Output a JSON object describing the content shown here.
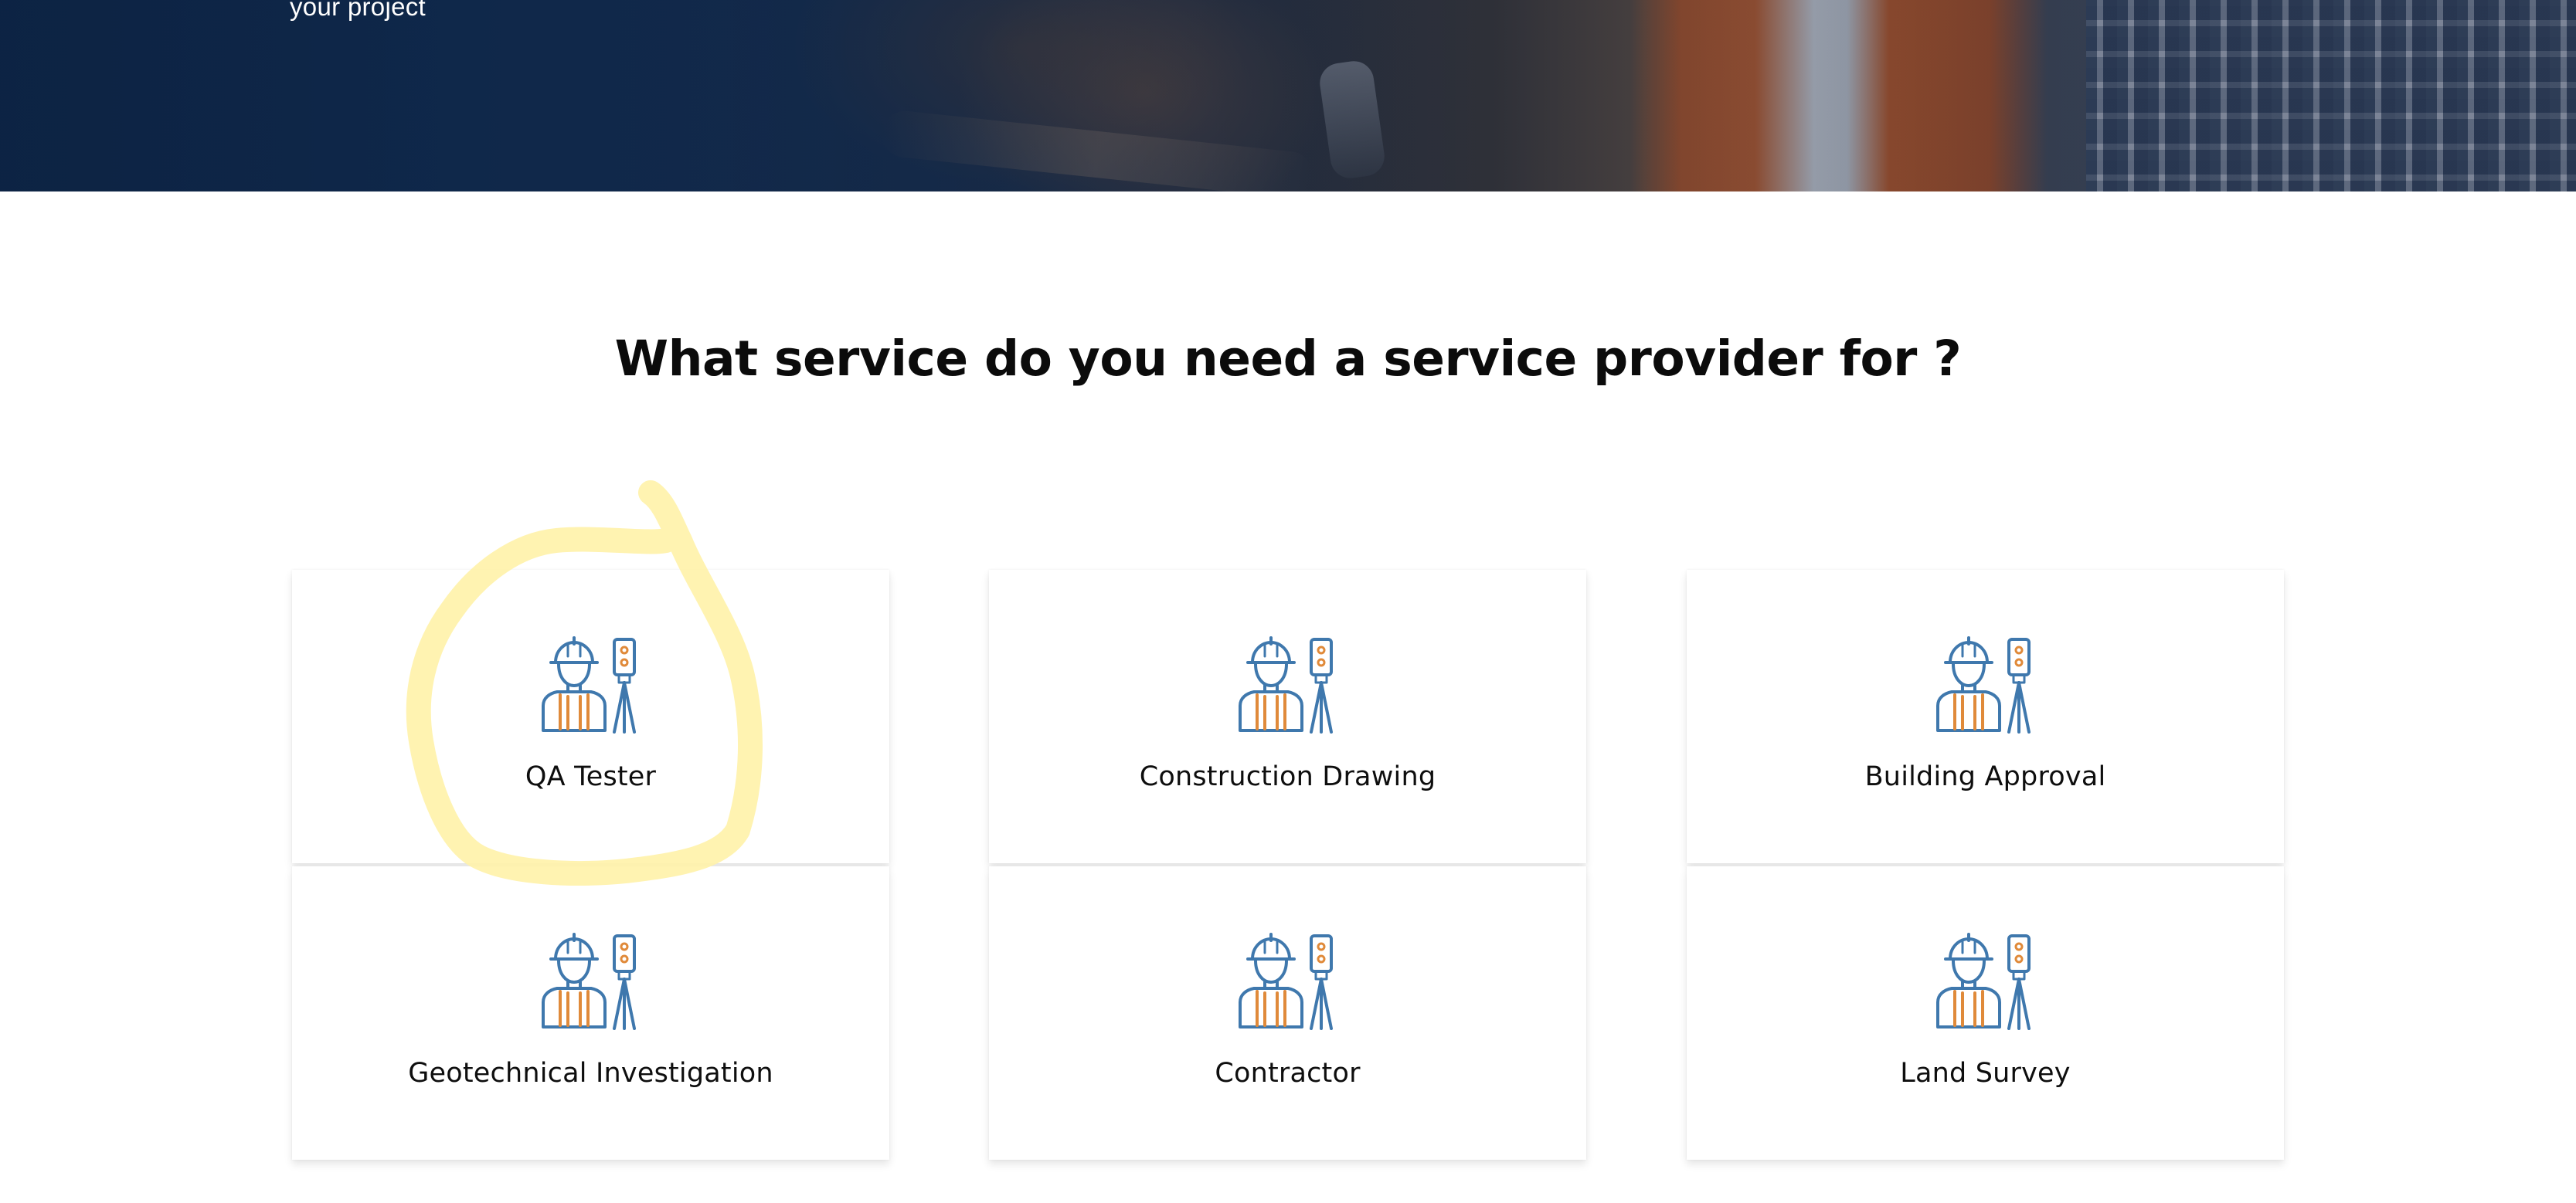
{
  "hero": {
    "subtitle_fragment": "your project"
  },
  "section": {
    "heading": "What service do you need a service provider for ?"
  },
  "services": [
    {
      "label": "QA Tester",
      "icon": "surveyor-worker-icon"
    },
    {
      "label": "Construction Drawing",
      "icon": "surveyor-worker-icon"
    },
    {
      "label": "Building Approval",
      "icon": "surveyor-worker-icon"
    },
    {
      "label": "Geotechnical Investigation",
      "icon": "surveyor-worker-icon"
    },
    {
      "label": "Contractor",
      "icon": "surveyor-worker-icon"
    },
    {
      "label": "Land Survey",
      "icon": "surveyor-worker-icon"
    }
  ],
  "colors": {
    "icon_blue": "#3f78ad",
    "icon_orange": "#e08a3a",
    "highlight": "#fff2a8",
    "hero_navy": "#0f2747"
  }
}
